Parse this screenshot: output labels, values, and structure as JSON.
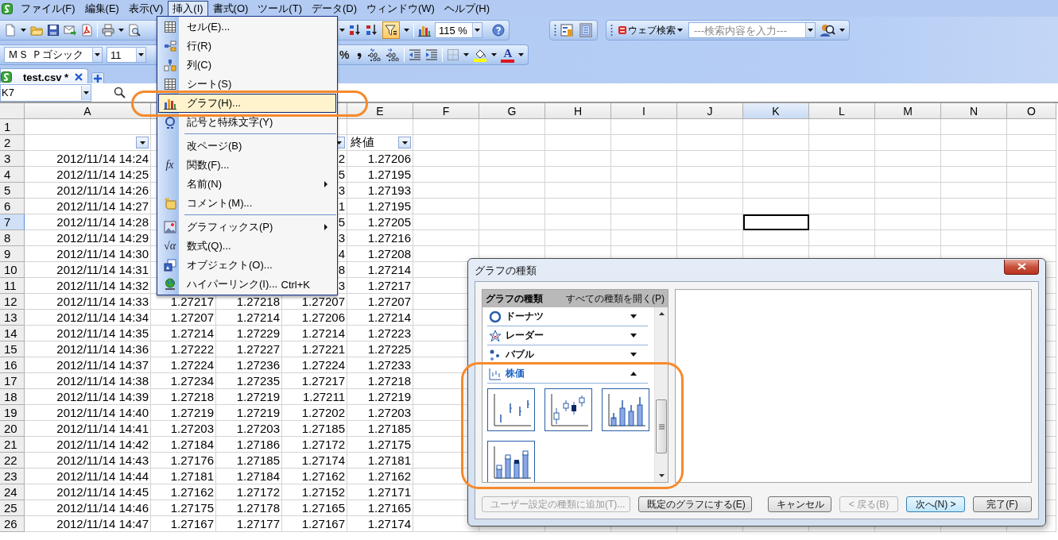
{
  "menu_bar": [
    {
      "label": "ファイル(F)",
      "selected": false
    },
    {
      "label": "編集(E)",
      "selected": false
    },
    {
      "label": "表示(V)",
      "selected": false
    },
    {
      "label": "挿入(I)",
      "selected": true
    },
    {
      "label": "書式(O)",
      "selected": false
    },
    {
      "label": "ツール(T)",
      "selected": false
    },
    {
      "label": "データ(D)",
      "selected": false
    },
    {
      "label": "ウィンドウ(W)",
      "selected": false
    },
    {
      "label": "ヘルプ(H)",
      "selected": false
    }
  ],
  "standard_toolbar": {
    "filter_on": true,
    "zoom": "115 %"
  },
  "web_search_toolbar": {
    "label": "ウェブ検索",
    "placeholder": "---検索内容を入力---"
  },
  "format_toolbar": {
    "font": "ＭＳ Ｐゴシック",
    "size": "11",
    "percent": "%",
    "font_color": "A"
  },
  "sheet_tabs": [
    {
      "label": "test.csv *",
      "selected": true
    }
  ],
  "formula_bar": {
    "name_box": "K7"
  },
  "insert_menu": {
    "items": [
      {
        "kind": "item",
        "label": "セル(E)...",
        "selected": false
      },
      {
        "kind": "item",
        "label": "行(R)",
        "selected": false
      },
      {
        "kind": "item",
        "label": "列(C)",
        "selected": false
      },
      {
        "kind": "item",
        "label": "シート(S)",
        "selected": false
      },
      {
        "kind": "item",
        "label": "グラフ(H)...",
        "selected": true
      },
      {
        "kind": "item",
        "label": "記号と特殊文字(Y)",
        "selected": false
      },
      {
        "kind": "separator"
      },
      {
        "kind": "item",
        "label": "改ページ(B)",
        "selected": false
      },
      {
        "kind": "item",
        "label": "関数(F)...",
        "selected": false,
        "glyph": "fx"
      },
      {
        "kind": "submenu",
        "label": "名前(N)",
        "selected": false
      },
      {
        "kind": "item",
        "label": "コメント(M)...",
        "selected": false
      },
      {
        "kind": "separator"
      },
      {
        "kind": "submenu",
        "label": "グラフィックス(P)",
        "selected": false
      },
      {
        "kind": "item",
        "label": "数式(Q)...",
        "selected": false,
        "glyph": "√α"
      },
      {
        "kind": "item",
        "label": "オブジェクト(O)...",
        "selected": false
      },
      {
        "kind": "item",
        "label": "ハイパーリンク(I)...",
        "selected": false,
        "shortcut": "Ctrl+K"
      }
    ]
  },
  "sheet": {
    "columns": [
      {
        "label": "A",
        "selected": false
      },
      {},
      {},
      {},
      {
        "label": "E",
        "selected": false
      },
      {
        "label": "F",
        "selected": false
      },
      {
        "label": "G",
        "selected": false
      },
      {
        "label": "H",
        "selected": false
      },
      {
        "label": "I",
        "selected": false
      },
      {
        "label": "J",
        "selected": false
      },
      {
        "label": "K",
        "selected": true
      },
      {
        "label": "L",
        "selected": false
      },
      {
        "label": "M",
        "selected": false
      },
      {
        "label": "N",
        "selected": false
      },
      {
        "label": "O",
        "selected": false
      }
    ],
    "rows": [
      {
        "header": "1",
        "selected": false,
        "kind": "blank"
      },
      {
        "header": "2",
        "selected": false,
        "kind": "header",
        "cells": [
          {
            "filter": true
          },
          null,
          null,
          {
            "filter": true
          },
          {
            "text": "終値",
            "filter": true
          }
        ]
      },
      {
        "header": "3",
        "selected": false,
        "kind": "data",
        "cells": [
          "2012/11/14 14:24",
          null,
          null,
          "2",
          "1.27206"
        ]
      },
      {
        "header": "4",
        "selected": false,
        "kind": "data",
        "cells": [
          "2012/11/14 14:25",
          null,
          null,
          "5",
          "1.27195"
        ]
      },
      {
        "header": "5",
        "selected": false,
        "kind": "data",
        "cells": [
          "2012/11/14 14:26",
          null,
          null,
          "3",
          "1.27193"
        ]
      },
      {
        "header": "6",
        "selected": false,
        "kind": "data",
        "cells": [
          "2012/11/14 14:27",
          null,
          null,
          "1",
          "1.27195"
        ]
      },
      {
        "header": "7",
        "selected": true,
        "kind": "data",
        "cells": [
          "2012/11/14 14:28",
          null,
          null,
          "5",
          "1.27205"
        ]
      },
      {
        "header": "8",
        "selected": false,
        "kind": "data",
        "cells": [
          "2012/11/14 14:29",
          null,
          null,
          "3",
          "1.27216"
        ]
      },
      {
        "header": "9",
        "selected": false,
        "kind": "data",
        "cells": [
          "2012/11/14 14:30",
          null,
          null,
          "4",
          "1.27208"
        ]
      },
      {
        "header": "10",
        "selected": false,
        "kind": "data",
        "cells": [
          "2012/11/14 14:31",
          null,
          null,
          "8",
          "1.27214"
        ]
      },
      {
        "header": "11",
        "selected": false,
        "kind": "data",
        "cells": [
          "2012/11/14 14:32",
          null,
          null,
          "3",
          "1.27217"
        ]
      },
      {
        "header": "12",
        "selected": false,
        "kind": "data",
        "cells": [
          "2012/11/14 14:33",
          "1.27217",
          "1.27218",
          "1.27207",
          "1.27207"
        ]
      },
      {
        "header": "13",
        "selected": false,
        "kind": "data",
        "cells": [
          "2012/11/14 14:34",
          "1.27207",
          "1.27214",
          "1.27206",
          "1.27214"
        ]
      },
      {
        "header": "14",
        "selected": false,
        "kind": "data",
        "cells": [
          "2012/11/14 14:35",
          "1.27214",
          "1.27229",
          "1.27214",
          "1.27223"
        ]
      },
      {
        "header": "15",
        "selected": false,
        "kind": "data",
        "cells": [
          "2012/11/14 14:36",
          "1.27222",
          "1.27227",
          "1.27221",
          "1.27225"
        ]
      },
      {
        "header": "16",
        "selected": false,
        "kind": "data",
        "cells": [
          "2012/11/14 14:37",
          "1.27224",
          "1.27236",
          "1.27224",
          "1.27233"
        ]
      },
      {
        "header": "17",
        "selected": false,
        "kind": "data",
        "cells": [
          "2012/11/14 14:38",
          "1.27234",
          "1.27235",
          "1.27217",
          "1.27218"
        ]
      },
      {
        "header": "18",
        "selected": false,
        "kind": "data",
        "cells": [
          "2012/11/14 14:39",
          "1.27218",
          "1.27219",
          "1.27211",
          "1.27219"
        ]
      },
      {
        "header": "19",
        "selected": false,
        "kind": "data",
        "cells": [
          "2012/11/14 14:40",
          "1.27219",
          "1.27219",
          "1.27202",
          "1.27203"
        ]
      },
      {
        "header": "20",
        "selected": false,
        "kind": "data",
        "cells": [
          "2012/11/14 14:41",
          "1.27203",
          "1.27203",
          "1.27185",
          "1.27185"
        ]
      },
      {
        "header": "21",
        "selected": false,
        "kind": "data",
        "cells": [
          "2012/11/14 14:42",
          "1.27184",
          "1.27186",
          "1.27172",
          "1.27175"
        ]
      },
      {
        "header": "22",
        "selected": false,
        "kind": "data",
        "cells": [
          "2012/11/14 14:43",
          "1.27176",
          "1.27185",
          "1.27174",
          "1.27181"
        ]
      },
      {
        "header": "23",
        "selected": false,
        "kind": "data",
        "cells": [
          "2012/11/14 14:44",
          "1.27181",
          "1.27184",
          "1.27162",
          "1.27162"
        ]
      },
      {
        "header": "24",
        "selected": false,
        "kind": "data",
        "cells": [
          "2012/11/14 14:45",
          "1.27162",
          "1.27172",
          "1.27152",
          "1.27171"
        ]
      },
      {
        "header": "25",
        "selected": false,
        "kind": "data",
        "cells": [
          "2012/11/14 14:46",
          "1.27175",
          "1.27178",
          "1.27165",
          "1.27165"
        ]
      },
      {
        "header": "26",
        "selected": false,
        "kind": "data",
        "cells": [
          "2012/11/14 14:47",
          "1.27167",
          "1.27177",
          "1.27167",
          "1.27174"
        ]
      }
    ]
  },
  "dialog": {
    "title": "グラフの種類",
    "list_title": "グラフの種類",
    "expand_all": "すべての種類を開く(P)",
    "categories": [
      {
        "label": "ドーナツ",
        "expanded": false
      },
      {
        "label": "レーダー",
        "expanded": false
      },
      {
        "label": "バブル",
        "expanded": false
      },
      {
        "label": "株価",
        "expanded": true,
        "subtypes": [
          {
            "kind": "hlc",
            "selected": false
          },
          {
            "kind": "ohlc",
            "selected": false
          },
          {
            "kind": "volume_hlc",
            "selected": false
          },
          {
            "kind": "volume_ohlc",
            "selected": false
          }
        ]
      }
    ],
    "left_buttons": [
      {
        "label": "ユーザー設定の種類に追加(T)...",
        "disabled": true,
        "default": false
      },
      {
        "label": "既定のグラフにする(E)",
        "disabled": false,
        "default": false
      }
    ],
    "right_buttons": [
      {
        "label": "キャンセル",
        "disabled": false,
        "default": false
      },
      {
        "label": "< 戻る(B)",
        "disabled": true,
        "default": false
      },
      {
        "label": "次へ(N) >",
        "disabled": false,
        "default": true
      },
      {
        "label": "完了(F)",
        "disabled": false,
        "default": false
      }
    ]
  }
}
